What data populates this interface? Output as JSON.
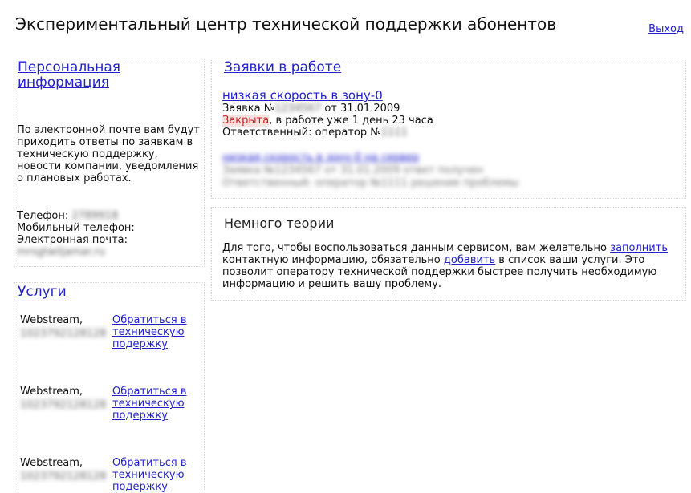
{
  "header": {
    "title": "Экспериментальный центр технической поддержки абонентов",
    "logout_label": "Выход"
  },
  "personal": {
    "heading": "Персональная информация",
    "description": "По электронной почте вам будут приходить ответы по заявкам в техническую поддержку, новости компании, уведомления о плановых работах.",
    "phone_label": "Телефон:",
    "phone_value": "2789918",
    "mobile_label": "Мобильный телефон:",
    "email_label": "Электронная почта:",
    "email_value": "mrsgtwiljamar.ru"
  },
  "services": {
    "heading": "Услуги",
    "items": [
      {
        "name": "Webstream,",
        "account": "1023792128128",
        "support_label": "Обратиться в техническую подержку"
      },
      {
        "name": "Webstream,",
        "account": "1023792128128",
        "support_label": "Обратиться в техническую подержку"
      },
      {
        "name": "Webstream,",
        "account": "1023792128128",
        "support_label": "Обратиться в техническую подержку"
      }
    ]
  },
  "tickets": {
    "heading": "Заявки в работе",
    "items": [
      {
        "title": "низкая скорость в зону-0",
        "number_prefix": "Заявка №",
        "number_value": "1234567",
        "date_text": "от 31.01.2009",
        "status": "Закрыта",
        "duration_text": ", в работе уже 1 день 23 часа",
        "responsible_prefix": "Ответственный: оператор №",
        "operator_value": "1111"
      }
    ],
    "blurred_item": {
      "title": "низкая скорость в зону-0 на сервер",
      "line1": "Заявка №1234567 от 31.01.2009 ответ получен",
      "line2": "Ответственный: оператор №1111 решение проблемы"
    }
  },
  "theory": {
    "heading": "Немного теории",
    "text_part1": "Для того, чтобы воспользоваться данным сервисом, вам желательно ",
    "link_fill": "заполнить",
    "text_part2": " контактную информацию, обязательно ",
    "link_add": "добавить",
    "text_part3": " в список ваши услуги. Это позволит оператору технической поддержки быстрее получить необходимую информацию и решить вашу проблему."
  }
}
